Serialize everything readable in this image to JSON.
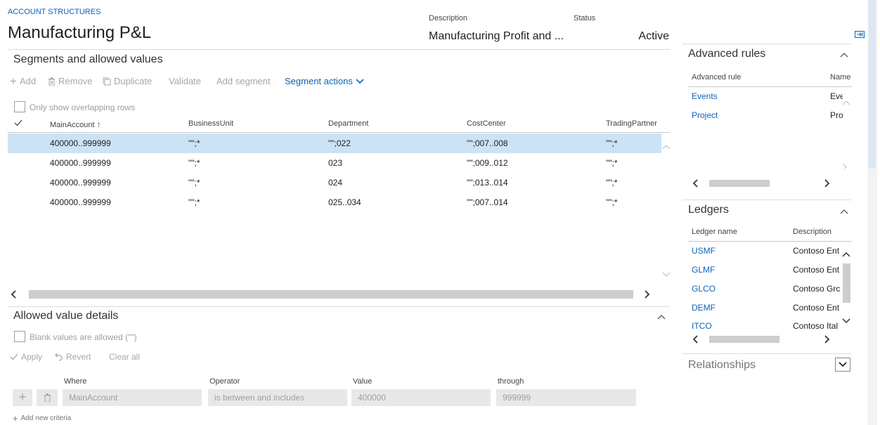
{
  "header": {
    "breadcrumb": "ACCOUNT STRUCTURES",
    "title": "Manufacturing P&L",
    "description_label": "Description",
    "description_value": "Manufacturing Profit and ...",
    "status_label": "Status",
    "status_value": "Active"
  },
  "segments": {
    "title": "Segments and allowed values",
    "toolbar": {
      "add": "Add",
      "remove": "Remove",
      "duplicate": "Duplicate",
      "validate": "Validate",
      "add_segment": "Add segment",
      "segment_actions": "Segment actions"
    },
    "overlap_label": "Only show overlapping rows",
    "columns": [
      "MainAccount",
      "BusinessUnit",
      "Department",
      "CostCenter",
      "TradingPartner"
    ],
    "rows": [
      [
        "400000..999999",
        "\"\";*",
        "\"\";022",
        "\"\";007..008",
        "\"\";*"
      ],
      [
        "400000..999999",
        "\"\";*",
        "023",
        "\"\";009..012",
        "\"\";*"
      ],
      [
        "400000..999999",
        "\"\";*",
        "024",
        "\"\";013..014",
        "\"\";*"
      ],
      [
        "400000..999999",
        "\"\";*",
        "025..034",
        "\"\";007..014",
        "\"\";*"
      ]
    ]
  },
  "details": {
    "title": "Allowed value details",
    "blank_label": "Blank values are allowed (\"\")",
    "apply": "Apply",
    "revert": "Revert",
    "clear_all": "Clear all",
    "where_label": "Where",
    "operator_label": "Operator",
    "value_label": "Value",
    "through_label": "through",
    "where_value": "MainAccount",
    "operator_value": "is between and includes",
    "value_value": "400000",
    "through_value": "999999",
    "add_criteria": "Add new criteria"
  },
  "advanced_rules": {
    "title": "Advanced rules",
    "col1": "Advanced rule",
    "col2": "Name",
    "rows": [
      {
        "rule": "Events",
        "name": "Eve"
      },
      {
        "rule": "Project",
        "name": "Pro"
      }
    ]
  },
  "ledgers": {
    "title": "Ledgers",
    "col1": "Ledger name",
    "col2": "Description",
    "rows": [
      {
        "name": "USMF",
        "desc": "Contoso Ent"
      },
      {
        "name": "GLMF",
        "desc": "Contoso Ent"
      },
      {
        "name": "GLCO",
        "desc": "Contoso Grc"
      },
      {
        "name": "DEMF",
        "desc": "Contoso Ent"
      },
      {
        "name": "ITCO",
        "desc": "Contoso Ital"
      }
    ]
  },
  "relationships": {
    "title": "Relationships"
  },
  "colors": {
    "accent": "#0b63b7",
    "selected_row": "#cce3f5",
    "input_bg": "#e8e8e8"
  }
}
